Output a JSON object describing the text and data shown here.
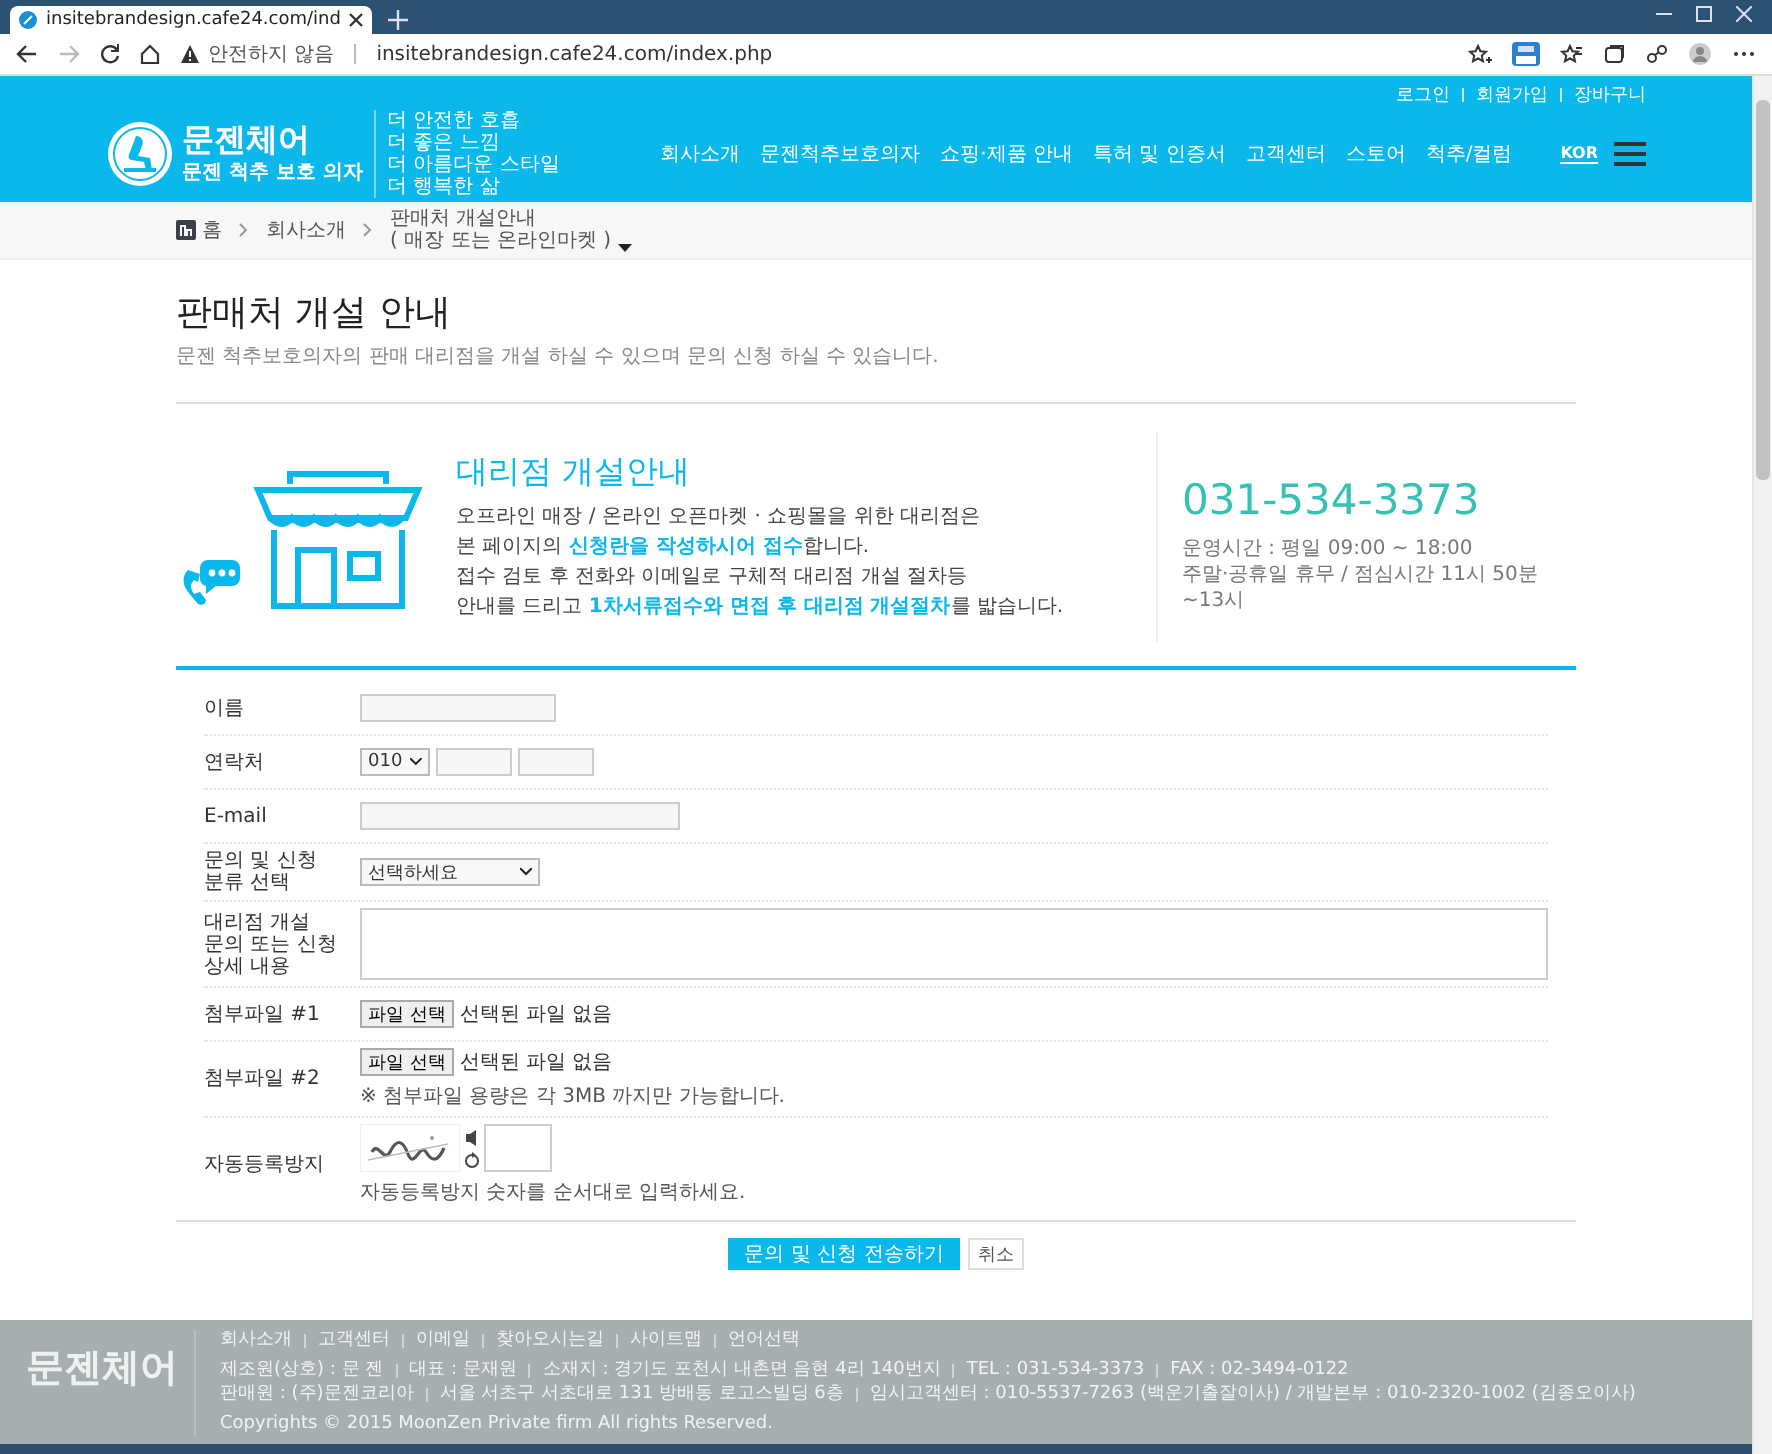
{
  "browser": {
    "tab_title": "insitebrandesign.cafe24.com/ind",
    "security_label": "안전하지 않음",
    "url": "insitebrandesign.cafe24.com/index.php",
    "forward_disabled": true
  },
  "header": {
    "top_links": [
      "로그인",
      "회원가입",
      "장바구니"
    ],
    "brand": "문젠체어",
    "brand_sub": "문젠 척추 보호 의자",
    "taglines": [
      "더 안전한 호흡",
      "더 좋은 느낌",
      "더 아름다운 스타일",
      "더 행복한 삶"
    ],
    "menu": [
      "회사소개",
      "문젠척추보호의자",
      "쇼핑·제품 안내",
      "특허 및 인증서",
      "고객센터",
      "스토어",
      "척추/컬럼"
    ],
    "language": "KOR"
  },
  "breadcrumb": {
    "home": "홈",
    "items": [
      "회사소개"
    ],
    "current_lines": [
      "판매처 개설안내",
      "( 매장 또는 온라인마켓 )"
    ]
  },
  "page": {
    "title": "판매처 개설 안내",
    "subtitle": "문젠 척추보호의자의 판매 대리점을 개설 하실 수 있으며 문의 신청 하실 수 있습니다."
  },
  "info": {
    "heading": "대리점 개설안내",
    "lines": [
      "오프라인 매장 / 온라인 오픈마켓 · 쇼핑몰을 위한 대리점은",
      "본 페이지의 **신청란을 작성하시어 접수**합니다.",
      "접수 검토 후 전화와 이메일로 구체적 대리점 개설 절차등",
      "안내를 드리고 **1차서류접수와 면접 후 대리점 개설절차**를 밟습니다."
    ],
    "phone": "031-534-3373",
    "hours": [
      "운영시간 : 평일 09:00 ~ 18:00",
      "주말·공휴일 휴무 / 점심시간 11시 50분~13시"
    ]
  },
  "form": {
    "rows": [
      {
        "kind": "name",
        "label_lines": [
          "이름"
        ]
      },
      {
        "kind": "phone",
        "label_lines": [
          "연락처"
        ],
        "value": "010"
      },
      {
        "kind": "email",
        "label_lines": [
          "E-mail"
        ]
      },
      {
        "kind": "select",
        "label_lines": [
          "문의 및 신청",
          "분류 선택"
        ],
        "value": "선택하세요"
      },
      {
        "kind": "textarea",
        "label_lines": [
          "대리점 개설",
          "문의 또는 신청",
          "상세 내용"
        ]
      },
      {
        "kind": "file",
        "label_lines": [
          "첨부파일 #1"
        ],
        "button": "파일 선택",
        "status": "선택된 파일 없음"
      },
      {
        "kind": "file",
        "label_lines": [
          "첨부파일 #2"
        ],
        "button": "파일 선택",
        "status": "선택된 파일 없음",
        "note": "※ 첨부파일 용량은 각 3MB 까지만 가능합니다."
      },
      {
        "kind": "captcha",
        "label_lines": [
          "자동등록방지"
        ],
        "note": "자동등록방지 숫자를 순서대로 입력하세요."
      }
    ]
  },
  "buttons": [
    {
      "kind": "primary",
      "label": "문의 및 신청 전송하기"
    },
    {
      "kind": "secondary",
      "label": "취소"
    }
  ],
  "footer": {
    "brand": "문젠체어",
    "links": [
      "회사소개",
      "고객센터",
      "이메일",
      "찾아오시는길",
      "사이트맵",
      "언어선택"
    ],
    "info_lines": [
      [
        "제조원(상호) : 문 젠",
        "대표 : 문재원",
        "소재지 : 경기도 포천시 내촌면 음현 4리 140번지",
        "TEL : 031-534-3373",
        "FAX : 02-3494-0122"
      ],
      [
        "판매원 : (주)문젠코리아",
        "서울 서초구 서초대로 131 방배동 로고스빌딩 6층",
        "임시고객센터 : 010-5537-7263 (백운기출잘이사) / 개발본부 : 010-2320-1002 (김종오이사)"
      ]
    ],
    "copyright": "Copyrights © 2015 MoonZen Private firm All rights Reserved."
  }
}
